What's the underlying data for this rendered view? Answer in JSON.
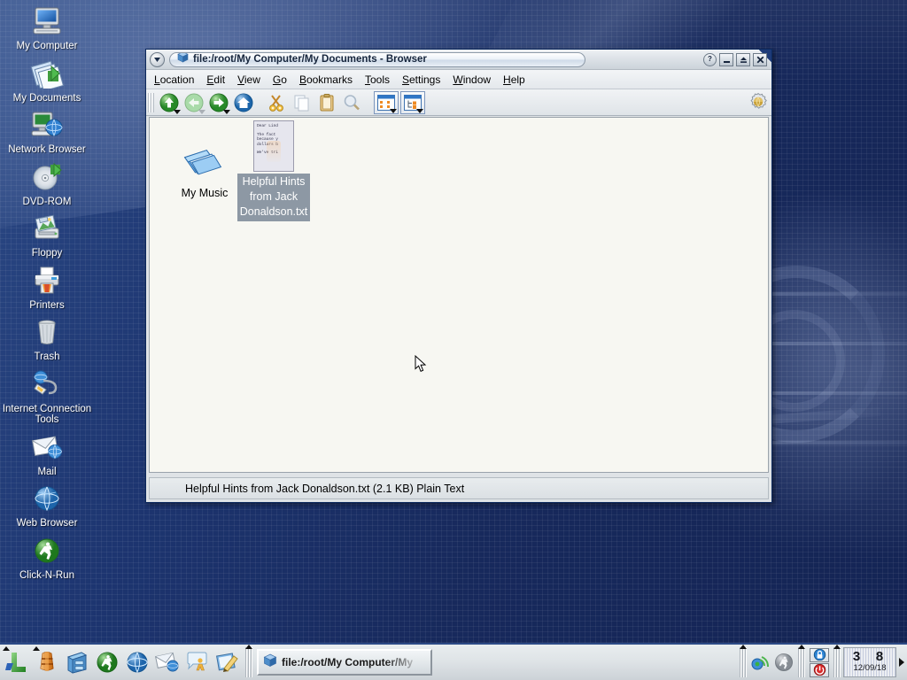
{
  "desktop": {
    "icons": [
      {
        "label": "My Computer",
        "icon": "computer-icon"
      },
      {
        "label": "My Documents",
        "icon": "documents-folder-icon"
      },
      {
        "label": "Network Browser",
        "icon": "network-computer-icon"
      },
      {
        "label": "DVD-ROM",
        "icon": "optical-disc-icon"
      },
      {
        "label": "Floppy",
        "icon": "floppy-disk-icon"
      },
      {
        "label": "Printers",
        "icon": "printer-icon"
      },
      {
        "label": "Trash",
        "icon": "trash-can-icon"
      },
      {
        "label": "Internet Connection Tools",
        "icon": "modem-globe-icon"
      },
      {
        "label": "Mail",
        "icon": "mail-envelope-globe-icon"
      },
      {
        "label": "Web Browser",
        "icon": "globe-icon"
      },
      {
        "label": "Click-N-Run",
        "icon": "running-man-green-icon"
      }
    ]
  },
  "window": {
    "title": "file:/root/My Computer/My Documents - Browser",
    "titlebar": {
      "window_menu_label": "▼",
      "help_label": "?",
      "minimize_label": "_",
      "maximize_label": "▴",
      "close_label": "✕"
    },
    "menus": [
      {
        "label": "Location",
        "accel": "L"
      },
      {
        "label": "Edit",
        "accel": "E"
      },
      {
        "label": "View",
        "accel": "V"
      },
      {
        "label": "Go",
        "accel": "G"
      },
      {
        "label": "Bookmarks",
        "accel": "B"
      },
      {
        "label": "Tools",
        "accel": "T"
      },
      {
        "label": "Settings",
        "accel": "S"
      },
      {
        "label": "Window",
        "accel": "W"
      },
      {
        "label": "Help",
        "accel": "H"
      }
    ],
    "toolbar": {
      "buttons": [
        {
          "name": "up-button",
          "icon": "arrow-up-green-icon",
          "dropdown": true,
          "enabled": true
        },
        {
          "name": "back-button",
          "icon": "arrow-left-green-icon",
          "dropdown": true,
          "enabled": false
        },
        {
          "name": "forward-button",
          "icon": "arrow-right-green-icon",
          "dropdown": true,
          "enabled": true
        },
        {
          "name": "home-button",
          "icon": "home-blue-icon",
          "dropdown": false,
          "enabled": true
        },
        {
          "name": "cut-button",
          "icon": "scissors-icon",
          "dropdown": false,
          "enabled": true
        },
        {
          "name": "copy-button",
          "icon": "copy-pages-icon",
          "dropdown": false,
          "enabled": false
        },
        {
          "name": "paste-button",
          "icon": "clipboard-icon",
          "dropdown": false,
          "enabled": true
        },
        {
          "name": "find-button",
          "icon": "magnifier-icon",
          "dropdown": false,
          "enabled": false
        },
        {
          "name": "icon-view-button",
          "icon": "icon-view-icon",
          "dropdown": true,
          "enabled": true
        },
        {
          "name": "tree-view-button",
          "icon": "tree-view-icon",
          "dropdown": true,
          "enabled": true
        }
      ],
      "config_icon": "gear-globe-icon"
    },
    "files": [
      {
        "name": "My Music",
        "icon": "music-folder-icon",
        "selected": false
      },
      {
        "name": "Helpful Hints from Jack Donaldson.txt",
        "display_lines": [
          "Helpful Hints",
          "from Jack",
          "Donaldson.txt"
        ],
        "icon": "text-file-thumbnail",
        "selected": true,
        "thumbnail_lines": [
          "Dear Lind",
          "",
          "The fact",
          "because y",
          "dollars b",
          "",
          "We've tri"
        ]
      }
    ],
    "statusbar": {
      "text": "Helpful Hints from Jack Donaldson.txt (2.1 KB)  Plain Text"
    }
  },
  "taskbar": {
    "quicklaunch": [
      {
        "name": "show-desktop-button",
        "icon": "lindows-l-icon",
        "arrow": true
      },
      {
        "name": "life-preserver-button",
        "icon": "life-preserver-icon",
        "arrow": true
      },
      {
        "name": "file-manager-button",
        "icon": "file-cabinet-icon",
        "arrow": false
      },
      {
        "name": "click-n-run-button",
        "icon": "running-man-green-icon",
        "arrow": false
      },
      {
        "name": "web-browser-button",
        "icon": "globe-icon",
        "arrow": false
      },
      {
        "name": "mail-button",
        "icon": "mail-envelope-globe-icon",
        "arrow": false
      },
      {
        "name": "chat-button",
        "icon": "chat-bubble-person-icon",
        "arrow": false
      },
      {
        "name": "text-editor-button",
        "icon": "notepad-pencil-icon",
        "arrow": false
      }
    ],
    "task_button": {
      "label": "file:/root/My Computer/My",
      "icon": "cube-blue-icon"
    },
    "tray": {
      "icons": [
        {
          "name": "network-monitor-icon"
        },
        {
          "name": "klipper-person-icon"
        }
      ],
      "session_buttons": [
        {
          "name": "lock-screen-button",
          "icon": "padlock-blue-icon"
        },
        {
          "name": "logout-button",
          "icon": "power-red-icon"
        }
      ],
      "clock": {
        "time": "3 8",
        "date": "12/09/18"
      },
      "expand_label": "▶"
    }
  },
  "colors": {
    "desktop_blue": "#1d3570",
    "selection_gray": "#8d98a4",
    "accent_green": "#2e9b2e",
    "window_bg": "#dfe3e6",
    "fileview_bg": "#f7f7f2"
  }
}
